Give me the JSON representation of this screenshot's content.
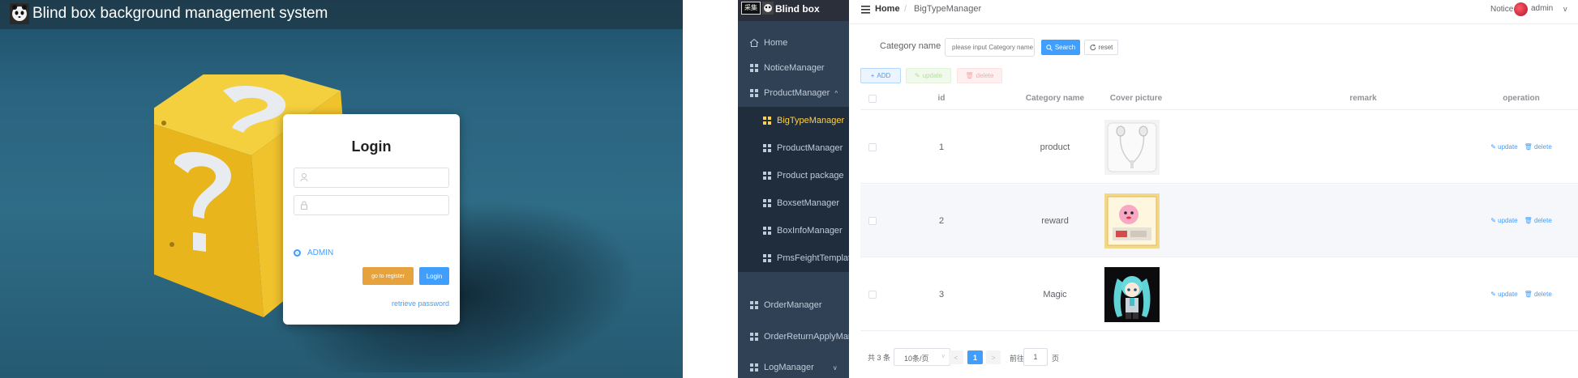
{
  "login_screen": {
    "title": "Blind box background management system",
    "card_title": "Login",
    "username_placeholder": "",
    "password_placeholder": "",
    "role_option": "ADMIN",
    "register_button": "go to register",
    "login_button": "Login",
    "retrieve_link": "retrieve password"
  },
  "admin": {
    "brand_badge": "采集",
    "brand_name": "Blind box",
    "sidebar": {
      "items": [
        {
          "label": "Home",
          "type": "top",
          "icon": "home-icon"
        },
        {
          "label": "NoticeManager",
          "type": "top",
          "icon": "grid-icon"
        },
        {
          "label": "ProductManager",
          "type": "top",
          "icon": "grid-icon",
          "expanded": true
        },
        {
          "label": "BigTypeManager",
          "type": "sub",
          "icon": "grid-icon",
          "active": true
        },
        {
          "label": "ProductManager",
          "type": "sub",
          "icon": "grid-icon"
        },
        {
          "label": "Product package",
          "type": "sub",
          "icon": "grid-icon"
        },
        {
          "label": "BoxsetManager",
          "type": "sub",
          "icon": "grid-icon"
        },
        {
          "label": "BoxInfoManager",
          "type": "sub",
          "icon": "grid-icon"
        },
        {
          "label": "PmsFeightTemplate",
          "type": "sub",
          "icon": "grid-icon"
        },
        {
          "label": "OrderManager",
          "type": "top",
          "icon": "grid-icon"
        },
        {
          "label": "OrderReturnApplyManager",
          "type": "top",
          "icon": "grid-icon"
        },
        {
          "label": "LogManager",
          "type": "top",
          "icon": "grid-icon"
        }
      ]
    },
    "breadcrumb": {
      "home": "Home",
      "current": "BigTypeManager"
    },
    "header": {
      "notice": "Notice",
      "username": "admin"
    },
    "filter": {
      "label": "Category name",
      "placeholder": "please input Category name",
      "search_button": "Search",
      "reset_button": "reset"
    },
    "toolbar": {
      "add": "ADD",
      "update": "update",
      "delete": "delete"
    },
    "table": {
      "columns": [
        "id",
        "Category name",
        "Cover picture",
        "remark",
        "operation"
      ],
      "rows": [
        {
          "id": "1",
          "name": "product",
          "remark": "",
          "cover": "earphones",
          "op_update": "update",
          "op_delete": "delete"
        },
        {
          "id": "2",
          "name": "reward",
          "remark": "",
          "cover": "pink-figure-box",
          "op_update": "update",
          "op_delete": "delete"
        },
        {
          "id": "3",
          "name": "Magic",
          "remark": "",
          "cover": "teal-twin-tail-doll",
          "op_update": "update",
          "op_delete": "delete"
        }
      ]
    },
    "pagination": {
      "total": "共 3 条",
      "page_size": "10条/页",
      "current_page": "1",
      "goto_label": "前往",
      "goto_value": "1",
      "page_suffix": "页"
    }
  },
  "colors": {
    "primary": "#409eff",
    "warning": "#e6a23c",
    "sidebar_bg": "#304156",
    "active_menu": "#ffd04b"
  }
}
